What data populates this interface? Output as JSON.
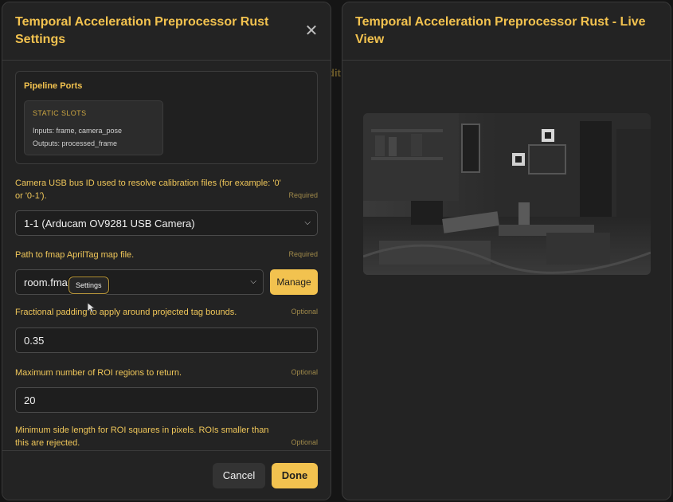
{
  "backdrop": {
    "fragment": "dit"
  },
  "settings": {
    "title": "Temporal Acceleration Preprocessor Rust Settings",
    "close_icon": "close-icon",
    "ports": {
      "title": "Pipeline Ports",
      "slot_label": "STATIC SLOTS",
      "inputs": "Inputs: frame, camera_pose",
      "outputs": "Outputs: processed_frame"
    },
    "fields": {
      "camera": {
        "label": "Camera USB bus ID used to resolve calibration files (for example: '0' or '0-1').",
        "tag": "Required",
        "value": "1-1 (Arducam OV9281 USB Camera)"
      },
      "fmap": {
        "label": "Path to fmap AprilTag map file.",
        "tag": "Required",
        "value": "room.fmap",
        "manage_label": "Manage"
      },
      "padding": {
        "label": "Fractional padding to apply around projected tag bounds.",
        "tag": "Optional",
        "value": "0.35"
      },
      "max_roi": {
        "label": "Maximum number of ROI regions to return.",
        "tag": "Optional",
        "value": "20"
      },
      "min_side": {
        "label": "Minimum side length for ROI squares in pixels. ROIs smaller than this are rejected.",
        "tag": "Optional"
      }
    },
    "tooltip": "Settings",
    "cancel_label": "Cancel",
    "done_label": "Done"
  },
  "liveview": {
    "title": "Temporal Acceleration Preprocessor Rust - Live View"
  },
  "colors": {
    "accent": "#f2c24f",
    "panel": "#232323",
    "background": "#151515"
  }
}
